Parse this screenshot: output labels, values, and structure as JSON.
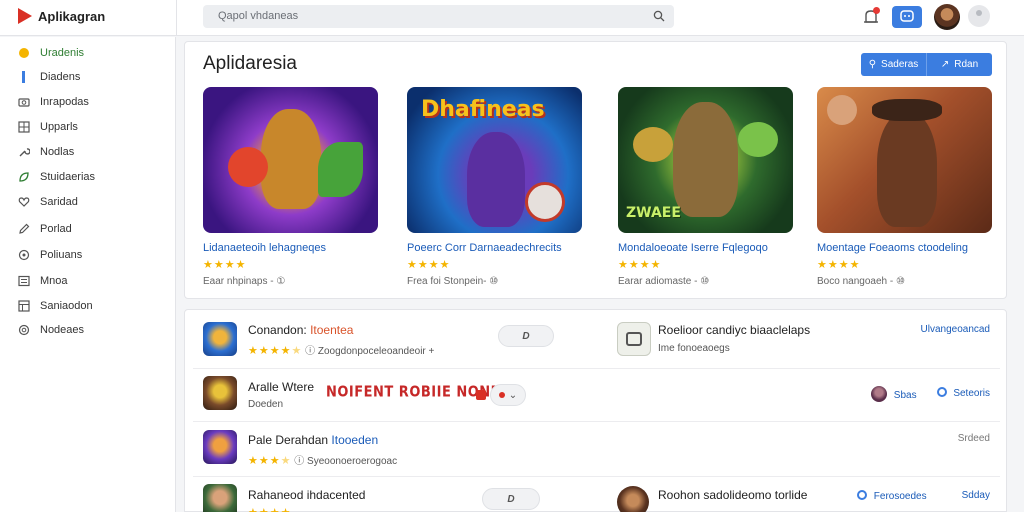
{
  "app": {
    "name": "Aplikagran"
  },
  "search": {
    "placeholder": "Qapol vhdaneas"
  },
  "sidebar": {
    "items": [
      {
        "label": "Uradenis",
        "icon": "coin-icon",
        "active": true
      },
      {
        "label": "Diadens",
        "icon": "bar-icon"
      },
      {
        "label": "Inrapodas",
        "icon": "camera-icon"
      },
      {
        "label": "Upparls",
        "icon": "grid-icon"
      },
      {
        "label": "Nodlas",
        "icon": "wrench-icon"
      },
      {
        "label": "Stuidaerias",
        "icon": "leaf-icon"
      },
      {
        "label": "Saridad",
        "icon": "heart-icon"
      },
      {
        "label": "Porlad",
        "icon": "pencil-icon"
      },
      {
        "label": "Poliuans",
        "icon": "target-icon"
      },
      {
        "label": "Mnoa",
        "icon": "list-icon"
      },
      {
        "label": "Saniaodon",
        "icon": "table-icon"
      },
      {
        "label": "Nodeaes",
        "icon": "settings-icon"
      }
    ]
  },
  "featured": {
    "title": "Aplidaresia",
    "actions": [
      {
        "label": "Saderas",
        "icon": "pin-icon"
      },
      {
        "label": "Rdan",
        "icon": "arrow-icon"
      }
    ],
    "cards": [
      {
        "title": "Lidanaeteoih lehagneqes",
        "stars": "★★★★",
        "rating": 4,
        "meta": "Eaar nhpinaps - ①"
      },
      {
        "title": "Poeerc Corr Darnaeadechrecits",
        "stars": "★★★★",
        "rating": 4,
        "meta": "Frea foi Stonpein- ⑩",
        "art_text": "Dhafineas"
      },
      {
        "title": "Mondaloeoate Iserre Fqlegoqo",
        "stars": "★★★★",
        "rating": 4,
        "meta": "Earar adiomaste - ⑩",
        "art_text": "ZWAEE"
      },
      {
        "title": "Moentage Foeaoms ctoodeling",
        "stars": "★★★★",
        "rating": 4,
        "meta": "Boco nangoaeh - ⑩"
      }
    ]
  },
  "list": {
    "rows": [
      {
        "title": "Conandon:",
        "title_accent": "Itoentea",
        "stars": "★★★★",
        "half": "★",
        "rating": 4.5,
        "sub": "Zoogdonpoceleoandeoir",
        "sub_trail": "+",
        "pill": "D"
      },
      {
        "title": "Aralle Wtere",
        "sub": "Doeden",
        "banner": "NOIFENT ROBIIE NONDO",
        "pill": ""
      },
      {
        "title": "Pale Derahdan",
        "title_accent": "Itooeden",
        "stars": "★★★",
        "half": "★",
        "rating": 3.5,
        "sub": "Syeoonoeroerogoac"
      },
      {
        "title": "Rahaneod ihdacented",
        "stars": "★★★★",
        "rating": 4,
        "pill": "D"
      }
    ],
    "right_rows": [
      {
        "title": "Roelioor candiyc biaaclelaps",
        "sub": "Ime fonoeaoegs",
        "link": "Ulvangeoancad"
      },
      {
        "mini_label": "Sbas",
        "link": "Seteoris"
      },
      {
        "muted": "Srdeed"
      },
      {
        "title": "Roohon sadolideomo torlide",
        "mid_link": "Ferosoedes",
        "link": "Sdday"
      }
    ]
  },
  "colors": {
    "accent": "#3b7de0",
    "brand": "#d93025",
    "star": "#f4b400",
    "active": "#2e7d32"
  }
}
